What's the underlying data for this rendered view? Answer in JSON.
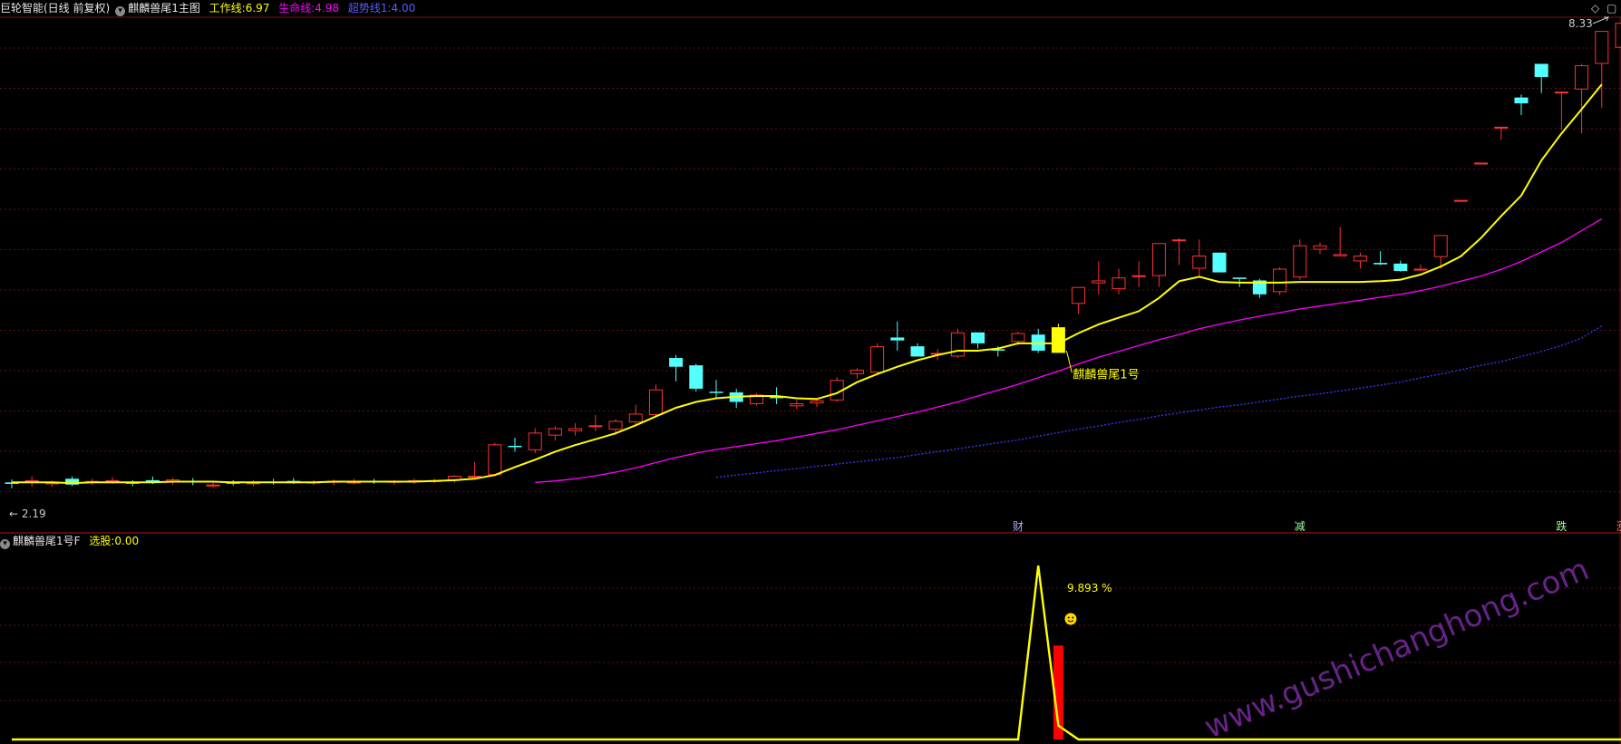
{
  "main_header": {
    "app": "巨轮智能(日线 前复权)",
    "indicator": "麒麟兽尾1主图",
    "work_line": {
      "label": "工作线:",
      "value": "6.97",
      "color": "#ffff00"
    },
    "life_line": {
      "label": "生命线:",
      "value": "4.98",
      "color": "#ff00ff"
    },
    "super_line": {
      "label": "超势线1:",
      "value": "4.00",
      "color": "#3a3aff"
    }
  },
  "sub_header": {
    "indicator": "麒麟兽尾1号F",
    "select": {
      "label": "选股:",
      "value": "0.00",
      "color": "#ffff00"
    }
  },
  "corner_icons": [
    "diamond-icon",
    "window-icon"
  ],
  "chart_data": [
    {
      "type": "candlestick",
      "pane": "main",
      "ylim": [
        1.9,
        8.6
      ],
      "grid": true,
      "colors": {
        "up": "#ff3232",
        "down": "#54ffff",
        "background": "#000000"
      },
      "high_label": "8.33",
      "low_label": "2.19",
      "signal_label": "麒麟兽尾1号",
      "signal_index": 52,
      "event_labels": [
        {
          "text": "财",
          "index": 50
        },
        {
          "text": "减",
          "index": 64
        },
        {
          "text": "跌",
          "index": 77
        },
        {
          "text": "涨",
          "index": 80
        }
      ],
      "candles": [
        [
          2.28,
          2.32,
          2.2,
          2.26
        ],
        [
          2.29,
          2.36,
          2.22,
          2.31
        ],
        [
          2.27,
          2.3,
          2.22,
          2.28
        ],
        [
          2.33,
          2.36,
          2.23,
          2.25
        ],
        [
          2.28,
          2.33,
          2.24,
          2.3
        ],
        [
          2.29,
          2.35,
          2.26,
          2.31
        ],
        [
          2.28,
          2.31,
          2.23,
          2.27
        ],
        [
          2.31,
          2.36,
          2.26,
          2.29
        ],
        [
          2.29,
          2.34,
          2.25,
          2.32
        ],
        [
          2.3,
          2.34,
          2.24,
          2.28
        ],
        [
          2.25,
          2.29,
          2.21,
          2.25
        ],
        [
          2.28,
          2.31,
          2.24,
          2.27
        ],
        [
          2.27,
          2.31,
          2.23,
          2.28
        ],
        [
          2.29,
          2.33,
          2.25,
          2.28
        ],
        [
          2.3,
          2.34,
          2.26,
          2.27
        ],
        [
          2.27,
          2.31,
          2.24,
          2.29
        ],
        [
          2.28,
          2.32,
          2.24,
          2.3
        ],
        [
          2.29,
          2.33,
          2.25,
          2.29
        ],
        [
          2.3,
          2.33,
          2.26,
          2.28
        ],
        [
          2.28,
          2.31,
          2.25,
          2.3
        ],
        [
          2.29,
          2.33,
          2.26,
          2.31
        ],
        [
          2.3,
          2.33,
          2.27,
          2.31
        ],
        [
          2.31,
          2.38,
          2.28,
          2.37
        ],
        [
          2.37,
          2.56,
          2.34,
          2.37
        ],
        [
          2.38,
          2.82,
          2.36,
          2.8
        ],
        [
          2.78,
          2.89,
          2.7,
          2.77
        ],
        [
          2.72,
          3.02,
          2.68,
          2.96
        ],
        [
          2.92,
          3.05,
          2.85,
          3.02
        ],
        [
          2.98,
          3.09,
          2.92,
          3.02
        ],
        [
          3.05,
          3.2,
          2.98,
          3.06
        ],
        [
          3.0,
          3.14,
          2.93,
          3.12
        ],
        [
          3.1,
          3.34,
          3.06,
          3.22
        ],
        [
          3.2,
          3.62,
          3.17,
          3.55
        ],
        [
          3.98,
          4.02,
          3.66,
          3.86
        ],
        [
          3.88,
          3.9,
          3.52,
          3.56
        ],
        [
          3.52,
          3.68,
          3.44,
          3.51
        ],
        [
          3.51,
          3.56,
          3.3,
          3.38
        ],
        [
          3.35,
          3.5,
          3.33,
          3.48
        ],
        [
          3.46,
          3.58,
          3.35,
          3.43
        ],
        [
          3.32,
          3.4,
          3.28,
          3.36
        ],
        [
          3.36,
          3.42,
          3.31,
          3.4
        ],
        [
          3.4,
          3.72,
          3.38,
          3.68
        ],
        [
          3.76,
          3.84,
          3.7,
          3.82
        ],
        [
          3.78,
          4.18,
          3.75,
          4.14
        ],
        [
          4.26,
          4.48,
          4.08,
          4.22
        ],
        [
          4.14,
          4.18,
          4.02,
          4.0
        ],
        [
          4.04,
          4.1,
          3.95,
          4.05
        ],
        [
          4.0,
          4.38,
          3.98,
          4.33
        ],
        [
          4.33,
          4.3,
          4.11,
          4.18
        ],
        [
          4.1,
          4.14,
          4.0,
          4.08
        ],
        [
          4.2,
          4.34,
          4.16,
          4.32
        ],
        [
          4.3,
          4.38,
          4.05,
          4.08
        ],
        [
          4.05,
          4.45,
          4.05,
          4.4
        ],
        [
          4.72,
          4.9,
          4.58,
          4.95
        ],
        [
          5.0,
          5.3,
          4.85,
          5.04
        ],
        [
          4.92,
          5.2,
          4.85,
          5.08
        ],
        [
          5.1,
          5.3,
          4.95,
          5.11
        ],
        [
          5.1,
          5.3,
          4.95,
          5.55
        ],
        [
          5.6,
          5.62,
          5.25,
          5.6
        ],
        [
          5.2,
          5.6,
          5.1,
          5.38
        ],
        [
          5.42,
          5.42,
          5.15,
          5.15
        ],
        [
          5.08,
          5.06,
          4.95,
          5.06
        ],
        [
          5.04,
          5.06,
          4.8,
          4.85
        ],
        [
          4.88,
          5.22,
          4.84,
          5.2
        ],
        [
          5.08,
          5.6,
          5.05,
          5.52
        ],
        [
          5.46,
          5.56,
          5.4,
          5.52
        ],
        [
          5.37,
          5.77,
          5.37,
          5.4
        ],
        [
          5.3,
          5.42,
          5.2,
          5.38
        ],
        [
          5.28,
          5.44,
          5.25,
          5.26
        ],
        [
          5.27,
          5.31,
          5.16,
          5.17
        ],
        [
          5.2,
          5.26,
          5.17,
          5.2
        ],
        [
          5.36,
          5.66,
          5.2,
          5.66
        ],
        [
          6.14,
          6.14,
          6.14,
          6.14
        ],
        [
          6.65,
          6.65,
          6.65,
          6.65
        ],
        [
          7.14,
          7.12,
          6.96,
          7.14
        ],
        [
          7.54,
          7.58,
          7.3,
          7.46
        ],
        [
          8.0,
          8.0,
          7.6,
          7.82
        ],
        [
          7.62,
          7.62,
          7.1,
          7.62
        ],
        [
          7.65,
          8.0,
          7.05,
          7.98
        ],
        [
          8.0,
          8.1,
          7.4,
          8.45
        ],
        [
          8.22,
          8.52,
          7.9,
          8.56
        ]
      ],
      "series": [
        {
          "name": "工作线",
          "color": "#ffff00",
          "values": [
            2.28,
            2.28,
            2.28,
            2.27,
            2.28,
            2.28,
            2.28,
            2.28,
            2.29,
            2.29,
            2.29,
            2.28,
            2.28,
            2.28,
            2.28,
            2.28,
            2.29,
            2.29,
            2.29,
            2.29,
            2.29,
            2.3,
            2.31,
            2.33,
            2.38,
            2.49,
            2.59,
            2.7,
            2.79,
            2.87,
            2.95,
            3.06,
            3.18,
            3.3,
            3.38,
            3.43,
            3.45,
            3.46,
            3.46,
            3.43,
            3.42,
            3.5,
            3.65,
            3.76,
            3.86,
            3.95,
            4.02,
            4.08,
            4.08,
            4.11,
            4.18,
            4.18,
            4.18,
            4.32,
            4.44,
            4.53,
            4.62,
            4.8,
            5.03,
            5.09,
            5.02,
            5.01,
            5.01,
            5.01,
            5.02,
            5.02,
            5.02,
            5.02,
            5.03,
            5.05,
            5.12,
            5.23,
            5.37,
            5.62,
            5.92,
            6.2,
            6.68,
            7.05,
            7.38,
            7.72
          ]
        },
        {
          "name": "生命线",
          "color": "#ff00ff",
          "values": [
            null,
            null,
            null,
            null,
            null,
            null,
            null,
            null,
            null,
            null,
            null,
            null,
            null,
            null,
            null,
            null,
            null,
            null,
            null,
            null,
            null,
            null,
            null,
            null,
            null,
            null,
            2.28,
            2.3,
            2.33,
            2.37,
            2.42,
            2.48,
            2.55,
            2.62,
            2.68,
            2.73,
            2.77,
            2.81,
            2.85,
            2.9,
            2.95,
            3.0,
            3.06,
            3.12,
            3.18,
            3.24,
            3.31,
            3.38,
            3.46,
            3.54,
            3.62,
            3.71,
            3.8,
            3.9,
            3.99,
            4.07,
            4.15,
            4.23,
            4.3,
            4.38,
            4.44,
            4.5,
            4.55,
            4.6,
            4.65,
            4.69,
            4.73,
            4.77,
            4.81,
            4.85,
            4.9,
            4.96,
            5.03,
            5.1,
            5.19,
            5.3,
            5.43,
            5.56,
            5.72,
            5.88
          ]
        },
        {
          "name": "超势线1",
          "color": "#3a3aff",
          "values": [
            null,
            null,
            null,
            null,
            null,
            null,
            null,
            null,
            null,
            null,
            null,
            null,
            null,
            null,
            null,
            null,
            null,
            null,
            null,
            null,
            null,
            null,
            null,
            null,
            null,
            null,
            null,
            null,
            null,
            null,
            null,
            null,
            null,
            null,
            null,
            2.35,
            2.38,
            2.41,
            2.44,
            2.47,
            2.5,
            2.53,
            2.56,
            2.59,
            2.62,
            2.66,
            2.7,
            2.74,
            2.78,
            2.82,
            2.86,
            2.91,
            2.96,
            3.01,
            3.05,
            3.1,
            3.14,
            3.19,
            3.23,
            3.27,
            3.31,
            3.34,
            3.38,
            3.42,
            3.46,
            3.49,
            3.53,
            3.57,
            3.61,
            3.65,
            3.71,
            3.76,
            3.82,
            3.88,
            3.93,
            4.0,
            4.07,
            4.15,
            4.25,
            4.42
          ]
        }
      ]
    },
    {
      "type": "line",
      "pane": "sub",
      "ylim": [
        0,
        11
      ],
      "grid": true,
      "label": "9.893 %",
      "icon": "smiley-icon",
      "series": [
        {
          "name": "选股",
          "color": "#ffff00",
          "values": [
            0,
            0,
            0,
            0,
            0,
            0,
            0,
            0,
            0,
            0,
            0,
            0,
            0,
            0,
            0,
            0,
            0,
            0,
            0,
            0,
            0,
            0,
            0,
            0,
            0,
            0,
            0,
            0,
            0,
            0,
            0,
            0,
            0,
            0,
            0,
            0,
            0,
            0,
            0,
            0,
            0,
            0,
            0,
            0,
            0,
            0,
            0,
            0,
            0,
            0,
            0,
            10.0,
            0.8,
            0,
            0,
            0,
            0,
            0,
            0,
            0,
            0,
            0,
            0,
            0,
            0,
            0,
            0,
            0,
            0,
            0,
            0,
            0,
            0,
            0,
            0,
            0,
            0,
            0,
            0,
            0,
            0
          ]
        }
      ],
      "bars": [
        {
          "index": 52,
          "value": 5.4,
          "color": "#ff0000"
        }
      ]
    }
  ],
  "watermark": "www.gushichanghong.com"
}
